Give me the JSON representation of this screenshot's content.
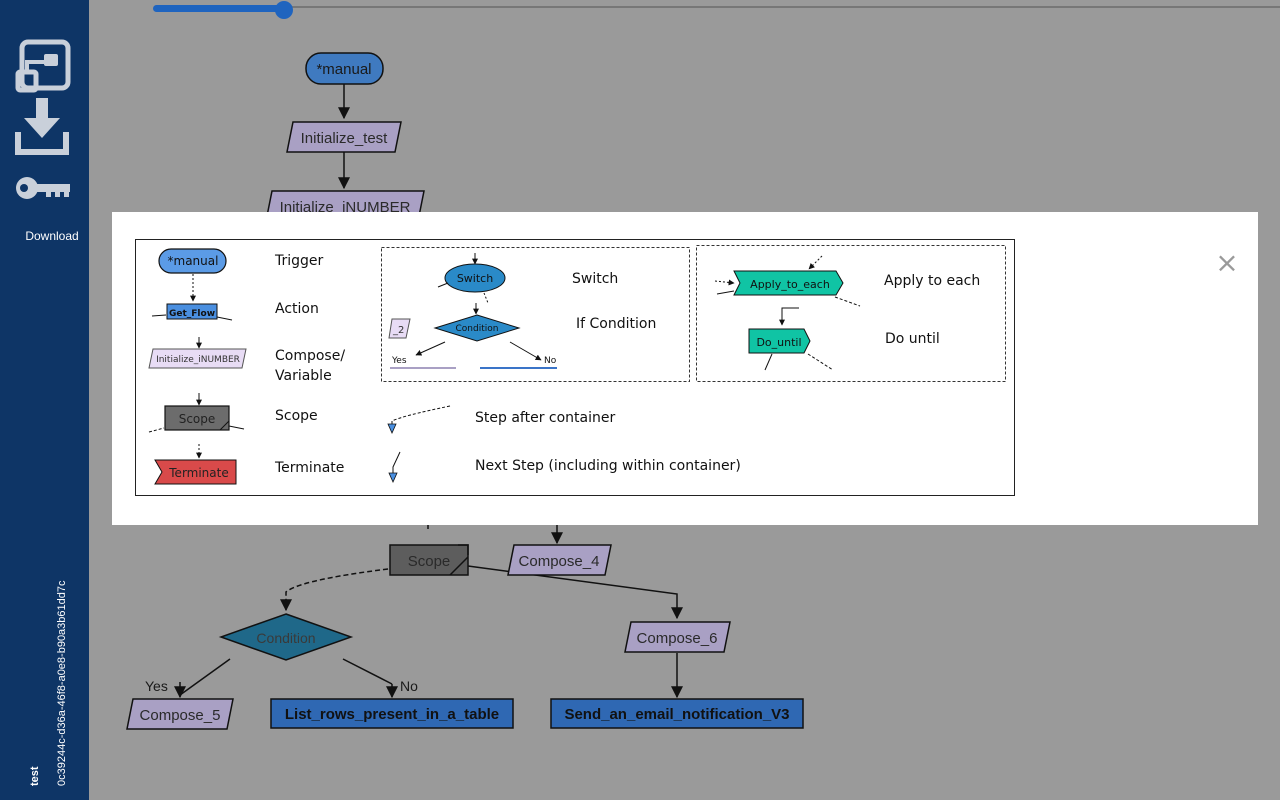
{
  "sidebar": {
    "download_label": "Download",
    "flow_name": "test",
    "flow_id": "0c39244c-d36a-46f8-a0e8-b90a3b61dd7c",
    "icons": [
      "flow-diagram-icon",
      "download-icon",
      "key-icon"
    ]
  },
  "slider": {
    "value_percent": 12
  },
  "flow": {
    "trigger": "*manual",
    "init_test": "Initialize_test",
    "init_number": "Initialize_iNUMBER",
    "scope": "Scope",
    "compose4": "Compose_4",
    "condition": "Condition",
    "yes": "Yes",
    "no": "No",
    "compose5": "Compose_5",
    "list_rows": "List_rows_present_in_a_table",
    "compose6": "Compose_6",
    "send_email": "Send_an_email_notification_V3"
  },
  "legend": {
    "close_symbol": "×",
    "trigger_sample": "*manual",
    "trigger_label": "Trigger",
    "action_sample": "Get_Flow",
    "action_label": "Action",
    "compose_sample": "Initialize_iNUMBER",
    "compose_label_1": "Compose/",
    "compose_label_2": "Variable",
    "scope_sample": "Scope",
    "scope_label": "Scope",
    "terminate_sample": "Terminate",
    "terminate_label": "Terminate",
    "switch_sample": "Switch",
    "switch_label": "Switch",
    "partial_label": "_2",
    "condition_sample": "Condition",
    "condition_label": "If Condition",
    "yes": "Yes",
    "no": "No",
    "apply_sample": "Apply_to_each",
    "apply_label": "Apply to each",
    "dountil_sample": "Do_until",
    "dountil_label": "Do until",
    "step_after_label": "Step after container",
    "next_step_label": "Next Step (including within container)"
  },
  "colors": {
    "sidebar": "#0e3566",
    "trigger": "#3f7ac0",
    "action": "#2f68b3",
    "compose": "#a9a0c4",
    "scope": "#5d5d5d",
    "condition": "#1f6889",
    "terminate": "#d24444",
    "loop": "#10c4a4"
  }
}
